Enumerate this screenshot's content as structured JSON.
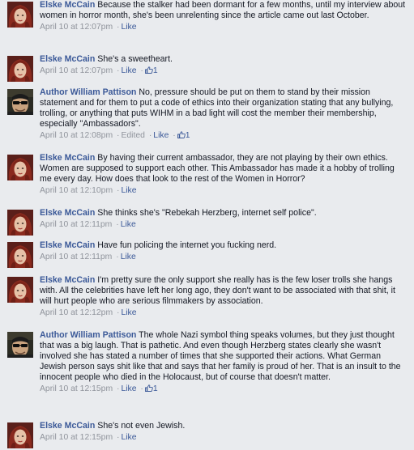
{
  "comments": [
    {
      "author": "Elske McCain",
      "avatar": "elske-avatar",
      "text": "Because the stalker had been dormant for a few months, until my interview about women in horror month, she's been unrelenting since the article came out last October.",
      "time": "April 10 at 12:07pm",
      "edited": "",
      "like_label": "Like",
      "like_count": ""
    },
    {
      "author": "Elske McCain",
      "avatar": "elske-avatar",
      "text": "She's a sweetheart.",
      "time": "April 10 at 12:07pm",
      "edited": "",
      "like_label": "Like",
      "like_count": "1"
    },
    {
      "author": "Author William Pattison",
      "avatar": "william-avatar",
      "text": "No, pressure should be put on them to stand by their mission statement and for them to put a code of ethics into their organization stating that any bullying, trolling, or anything that puts WIHM in a bad light will cost the member their membership, especially \"Ambassadors\".",
      "time": "April 10 at 12:08pm",
      "edited": "Edited",
      "like_label": "Like",
      "like_count": "1"
    },
    {
      "author": "Elske McCain",
      "avatar": "elske-avatar",
      "text": "By having their current ambassador, they are not playing by their own ethics. Women are supposed to support each other. This Ambassador has made it a hobby of trolling me every day. How does that look to the rest of the Women in Horror?",
      "time": "April 10 at 12:10pm",
      "edited": "",
      "like_label": "Like",
      "like_count": ""
    },
    {
      "author": "Elske McCain",
      "avatar": "elske-avatar",
      "text": "She thinks she's \"Rebekah Herzberg, internet self police\".",
      "time": "April 10 at 12:11pm",
      "edited": "",
      "like_label": "Like",
      "like_count": ""
    },
    {
      "author": "Elske McCain",
      "avatar": "elske-avatar",
      "text": "Have fun policing the internet you fucking nerd.",
      "time": "April 10 at 12:11pm",
      "edited": "",
      "like_label": "Like",
      "like_count": ""
    },
    {
      "author": "Elske McCain",
      "avatar": "elske-avatar",
      "text": "I'm pretty sure the only support she really has is the few loser trolls she hangs with. All the celebrities have left her long ago, they don't want to be associated with that shit, it will hurt people who are serious filmmakers by association.",
      "time": "April 10 at 12:12pm",
      "edited": "",
      "like_label": "Like",
      "like_count": ""
    },
    {
      "author": "Author William Pattison",
      "avatar": "william-avatar",
      "text": "The whole Nazi symbol thing speaks volumes, but they just thought that was a big laugh. That is pathetic. And even though Herzberg states clearly she wasn't involved she has stated a number of times that she supported their actions. What German Jewish person says shit like that and says that her family is proud of her. That is an insult to the innocent people who died in the Holocaust, but of course that doesn't matter.",
      "time": "April 10 at 12:15pm",
      "edited": "",
      "like_label": "Like",
      "like_count": "1"
    },
    {
      "author": "Elske McCain",
      "avatar": "elske-avatar",
      "text": "She's not even Jewish.",
      "time": "April 10 at 12:15pm",
      "edited": "",
      "like_label": "Like",
      "like_count": ""
    }
  ],
  "colors": {
    "background": "#e9ebee",
    "author_link": "#3b5998",
    "meta_text": "#90949c",
    "body_text": "#141823"
  }
}
